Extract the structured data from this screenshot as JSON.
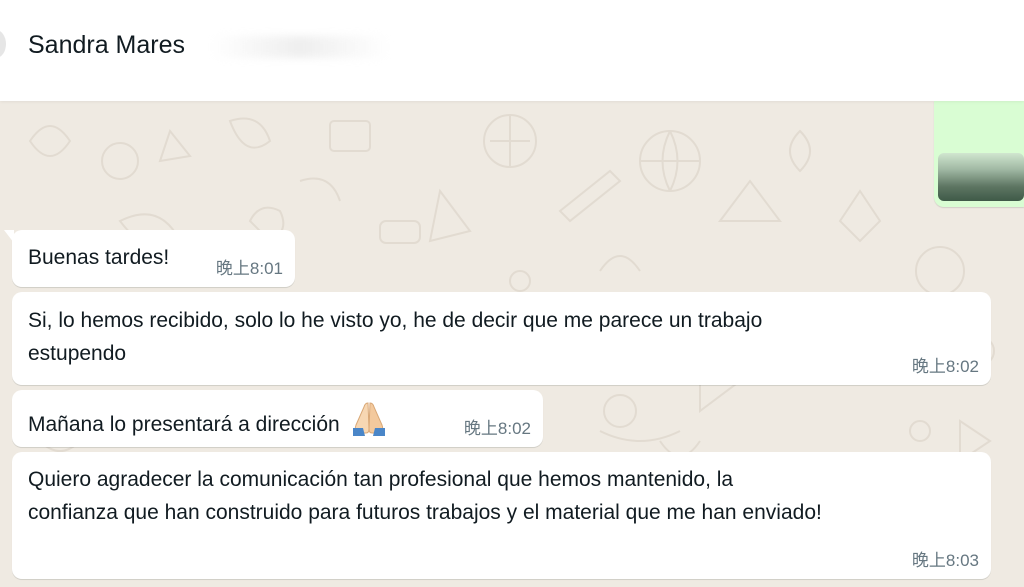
{
  "header": {
    "contact_name": "Sandra Mares"
  },
  "messages": [
    {
      "text": "Buenas tardes!",
      "time": "晚上8:01",
      "direction": "incoming"
    },
    {
      "text": "Si, lo hemos recibido, solo lo he visto yo, he de decir que me parece un trabajo\nestupendo",
      "time": "晚上8:02",
      "direction": "incoming"
    },
    {
      "text": "Mañana lo presentará a dirección",
      "emoji": "folded-hands-icon",
      "time": "晚上8:02",
      "direction": "incoming"
    },
    {
      "text": "Quiero agradecer la comunicación tan profesional que hemos mantenido, la\nconfianza que han construido para futuros trabajos y el material que me han enviado!",
      "time": "晚上8:03",
      "direction": "incoming"
    }
  ],
  "colors": {
    "chat_background": "#efeae2",
    "incoming_bubble": "#ffffff",
    "outgoing_bubble": "#d9fdd3",
    "timestamp": "#667781"
  }
}
